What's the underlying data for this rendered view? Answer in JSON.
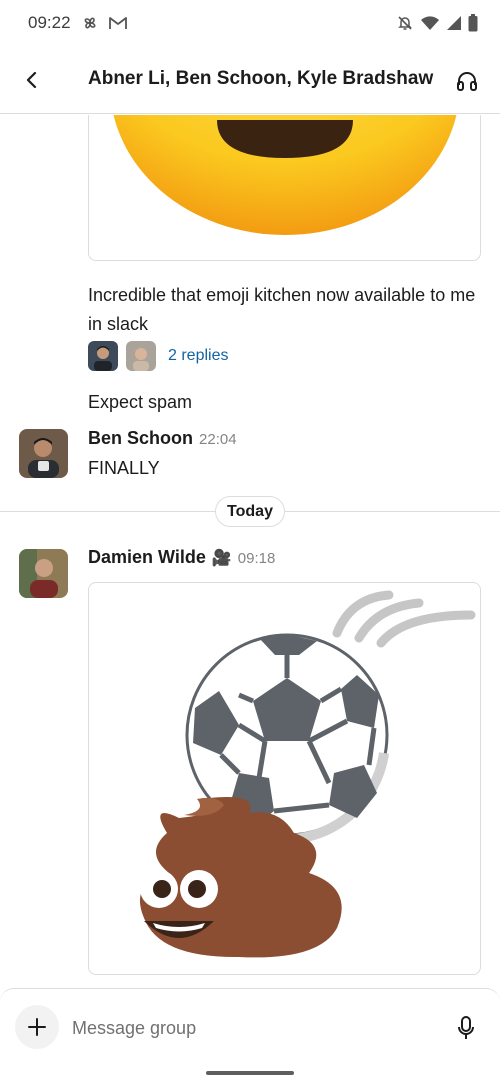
{
  "status_bar": {
    "time": "09:22",
    "left_icons": [
      "pinwheel-icon",
      "gmail-icon"
    ],
    "right_icons": [
      "bell-off-icon",
      "wifi-icon",
      "signal-icon",
      "battery-icon"
    ]
  },
  "header": {
    "title": "Abner Li, Ben Schoon, Kyle Bradshaw",
    "back_icon": "back-arrow-icon",
    "huddle_icon": "headphones-icon"
  },
  "messages": [
    {
      "type": "image",
      "image": "emoji-kitchen-grin-crop"
    },
    {
      "type": "text",
      "text": "Incredible that emoji kitchen now available to me in slack"
    },
    {
      "type": "thread",
      "replies_label": "2 replies",
      "reply_avatars": [
        "avatar-reply-1",
        "avatar-reply-2"
      ]
    },
    {
      "type": "text",
      "text": "Expect spam"
    },
    {
      "type": "message",
      "sender": "Ben Schoon",
      "time": "22:04",
      "text": "FINALLY"
    }
  ],
  "day_divider": "Today",
  "latest_message": {
    "sender": "Damien Wilde",
    "status_emoji": "🎥",
    "time": "09:18",
    "image": "emoji-kitchen-soccer-poop"
  },
  "composer": {
    "placeholder": "Message group"
  },
  "colors": {
    "link": "#1264a3",
    "divider": "#dddddd",
    "timestamp": "#858585"
  }
}
